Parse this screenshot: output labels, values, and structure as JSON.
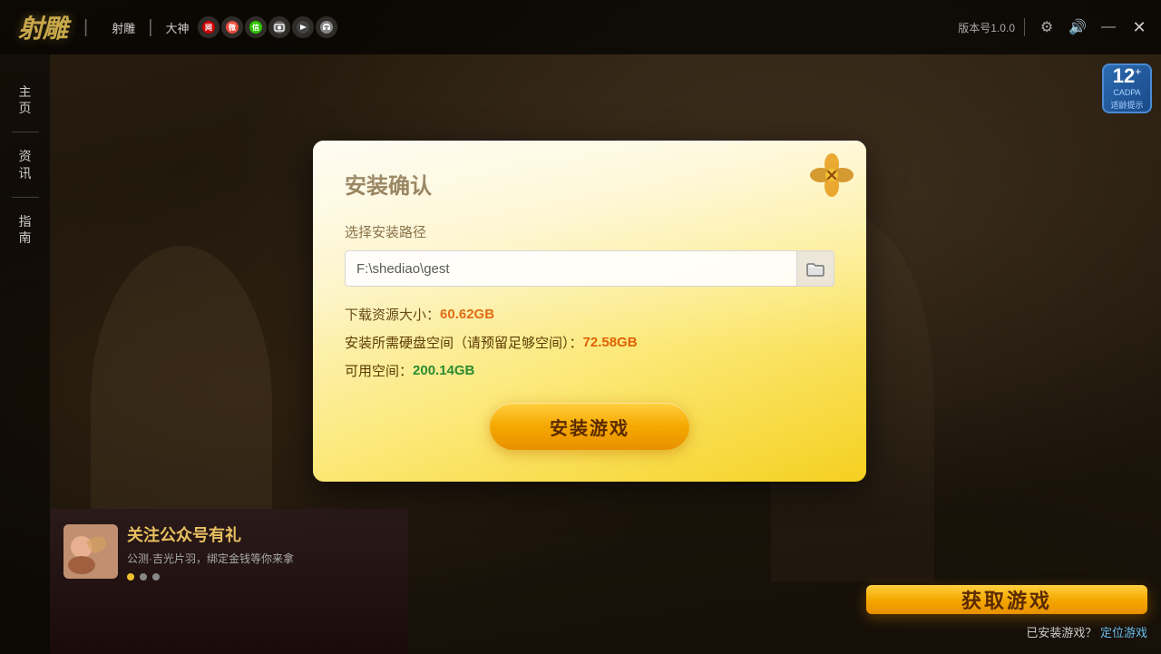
{
  "app": {
    "title": "射雕",
    "version": "版本号1.0.0"
  },
  "topbar": {
    "logo": "射雕",
    "nav_items": [
      {
        "id": "game",
        "label": "射雕",
        "icon": "🎮"
      },
      {
        "id": "dashen",
        "label": "大神",
        "icon": "🌟"
      },
      {
        "id": "163music",
        "label": "音乐",
        "icon": "🎵"
      },
      {
        "id": "weibo",
        "label": "微博",
        "icon": "📱"
      },
      {
        "id": "wechat",
        "label": "微信",
        "icon": "💬"
      },
      {
        "id": "photo",
        "label": "图片",
        "icon": "📷"
      },
      {
        "id": "video",
        "label": "视频",
        "icon": "📹"
      },
      {
        "id": "headset",
        "label": "客服",
        "icon": "🎧"
      }
    ],
    "version_label": "版本号1.0.0",
    "controls": {
      "settings": "⚙",
      "sound": "🔊",
      "minimize": "—",
      "close": "✕"
    }
  },
  "sidebar": {
    "items": [
      {
        "id": "home",
        "label": "主页",
        "chars": [
          "主",
          "页"
        ]
      },
      {
        "id": "news",
        "label": "资讯",
        "chars": [
          "资",
          "讯"
        ]
      },
      {
        "id": "guide",
        "label": "指南",
        "chars": [
          "指",
          "南"
        ]
      }
    ]
  },
  "age_badge": {
    "number": "12",
    "plus": "+",
    "line1": "CADPA",
    "line2": "适龄提示"
  },
  "dialog": {
    "title": "安装确认",
    "path_label": "选择安装路径",
    "path_value": "F:\\shediao\\gest",
    "path_placeholder": "F:\\shediao\\gest",
    "download_size_label": "下载资源大小：",
    "download_size_value": "60.62GB",
    "disk_space_label": "安装所需硬盘空间（请预留足够空间）：",
    "disk_space_value": "72.58GB",
    "available_label": "可用空间：",
    "available_value": "200.14GB",
    "install_button": "安装游戏",
    "close_icon": "✕"
  },
  "bottom": {
    "banner_title": "关注公众号有礼",
    "banner_subtitle": "公测·吉光片羽，绑定金钱等你来拿",
    "dots": [
      {
        "active": true
      },
      {
        "active": false
      },
      {
        "active": false
      }
    ],
    "get_game_button": "获取游戏",
    "installed_text": "已安装游戏？",
    "locate_text": "定位游戏"
  }
}
